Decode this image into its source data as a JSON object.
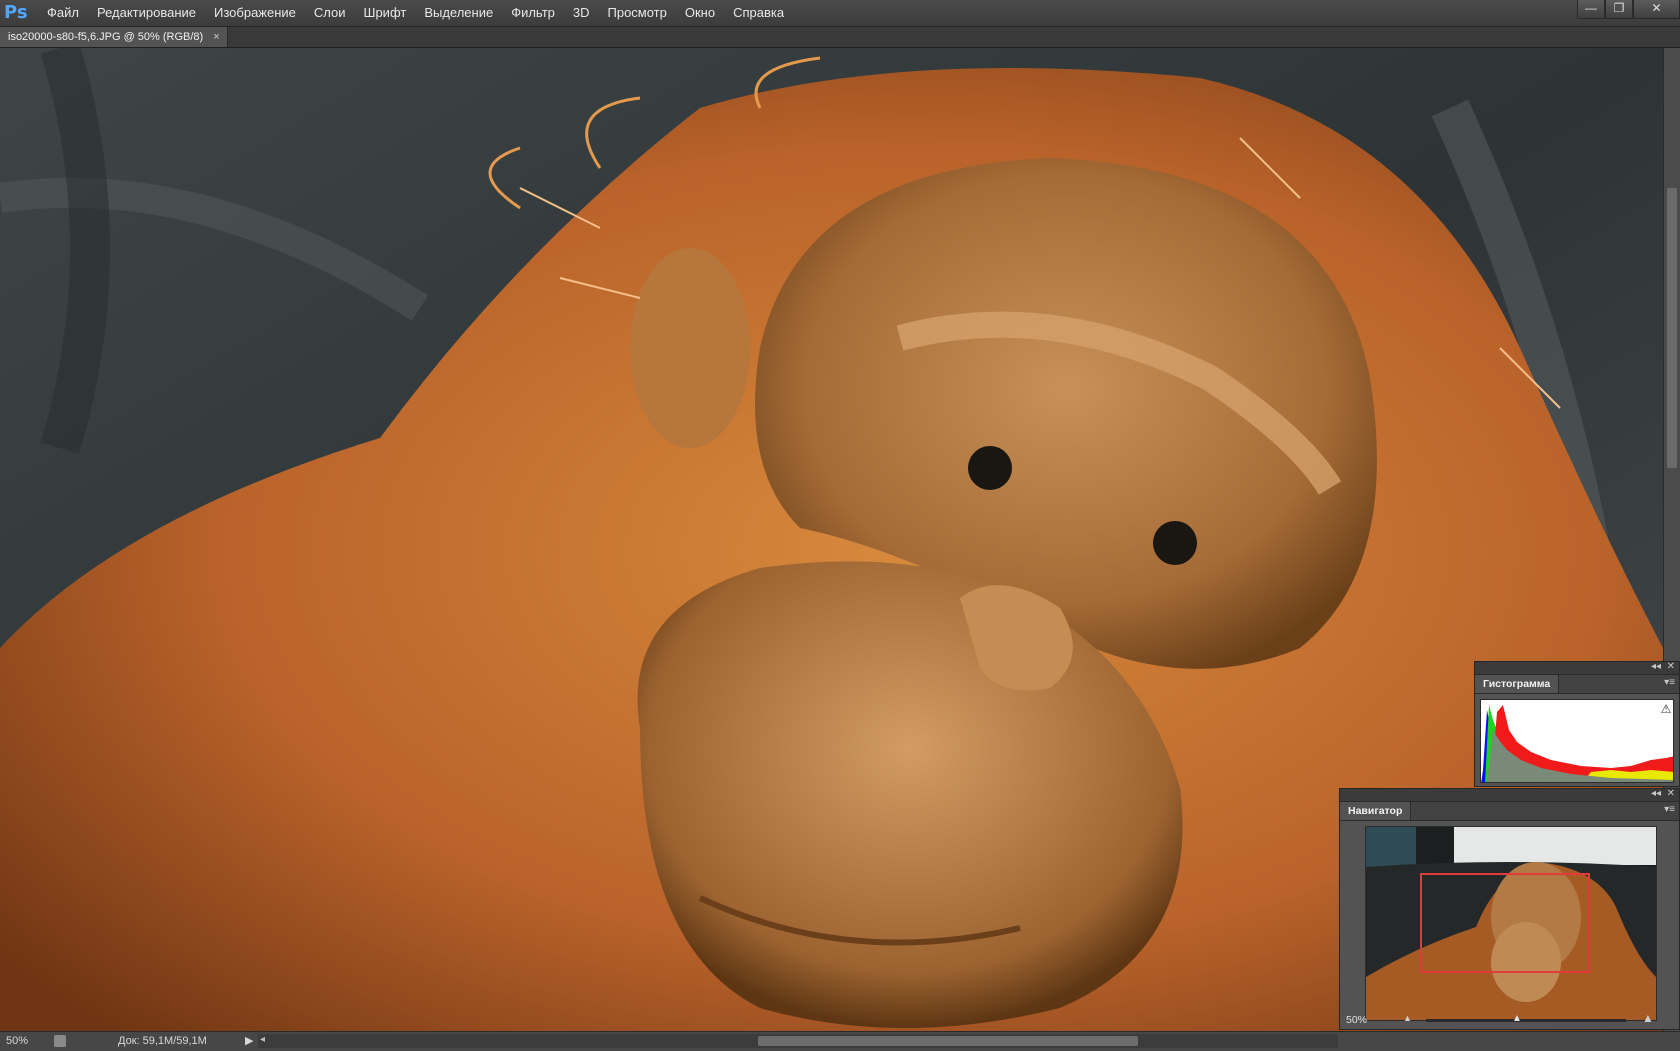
{
  "app": {
    "logo": "Ps"
  },
  "menu": [
    "Файл",
    "Редактирование",
    "Изображение",
    "Слои",
    "Шрифт",
    "Выделение",
    "Фильтр",
    "3D",
    "Просмотр",
    "Окно",
    "Справка"
  ],
  "window_controls": {
    "minimize": "—",
    "restore": "❐",
    "close": "✕"
  },
  "document": {
    "tab_title": "iso20000-s80-f5,6.JPG @ 50% (RGB/8)",
    "tab_close": "×"
  },
  "status": {
    "zoom": "50%",
    "doc_size": "Док: 59,1M/59,1M",
    "arrow": "▶",
    "scroll_left": "◂"
  },
  "histogram_panel": {
    "collapse": "◂◂",
    "close": "✕",
    "tab": "Гистограмма",
    "menu": "▾≡",
    "warning_icon": "warning-icon"
  },
  "navigator_panel": {
    "collapse": "◂◂",
    "close": "✕",
    "tab": "Навигатор",
    "menu": "▾≡",
    "zoom": "50%",
    "zoom_out": "▲",
    "zoom_in": "▲",
    "slider_knob": "▲",
    "zoom_level_fraction": 0.45
  },
  "colors": {
    "accent_logo": "#4fa7ff",
    "nav_rect": "#e23b3b"
  }
}
